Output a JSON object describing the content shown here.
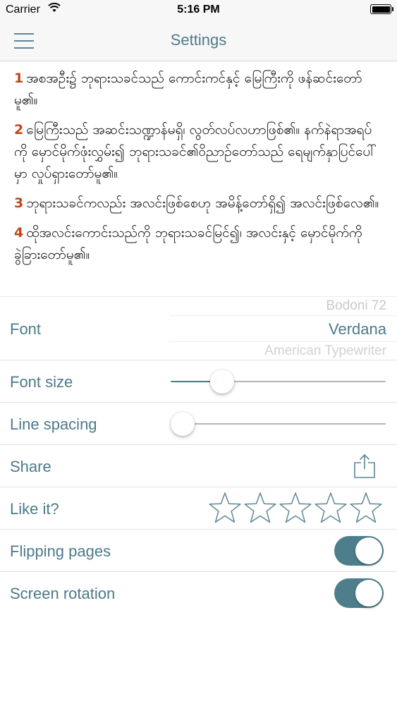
{
  "status_bar": {
    "carrier": "Carrier",
    "time": "5:16 PM",
    "battery_level": 1.0
  },
  "nav": {
    "title": "Settings"
  },
  "reader": {
    "verses": [
      {
        "number": "1",
        "text": "အစအဦး၌ ဘုရားသခင်သည် ကောင်းကင်နှင့် မြေကြီးကို ဖန်ဆင်းတော်မူ၏။"
      },
      {
        "number": "2",
        "text": "မြေကြီးသည် အဆင်းသဏ္ဍာန်မရှိ၊ လွတ်လပ်လဟာဖြစ်၏။ နက်နဲရာအရပ်ကို မှောင်မိုက်ဖုံးလွှမ်း၍ ဘုရားသခင်၏ဝိညာဉ်တော်သည် ရေမျက်နှာပြင်ပေါ်မှာ လှုပ်ရှားတော်မူ၏။"
      },
      {
        "number": "3",
        "text": "ဘုရားသခင်ကလည်း အလင်းဖြစ်စေဟု အမိန့်တော်ရှိ၍ အလင်းဖြစ်လေ၏။"
      },
      {
        "number": "4",
        "text": "ထိုအလင်းကောင်းသည်ကို ဘုရားသခင်မြင်၍၊ အလင်းနှင့် မှောင်မိုက်ကို ခွဲခြားတော်မူ၏။"
      }
    ]
  },
  "settings": {
    "font": {
      "label": "Font",
      "options": [
        "Bodoni 72",
        "Verdana",
        "American Typewriter"
      ],
      "selected": "Verdana"
    },
    "font_size": {
      "label": "Font size",
      "value": 0.24
    },
    "line_spacing": {
      "label": "Line spacing",
      "value": 0.05
    },
    "share": {
      "label": "Share",
      "icon": "share-icon"
    },
    "like": {
      "label": "Like it?",
      "stars_total": 5,
      "stars_filled": 0,
      "star_color": "#5c8797"
    },
    "flipping_pages": {
      "label": "Flipping pages",
      "on": true
    },
    "screen_rotation": {
      "label": "Screen rotation",
      "on": true
    }
  },
  "colors": {
    "accent": "#4e7e8c",
    "verse_number": "#c1441a",
    "label_text": "#4c7a8a"
  }
}
